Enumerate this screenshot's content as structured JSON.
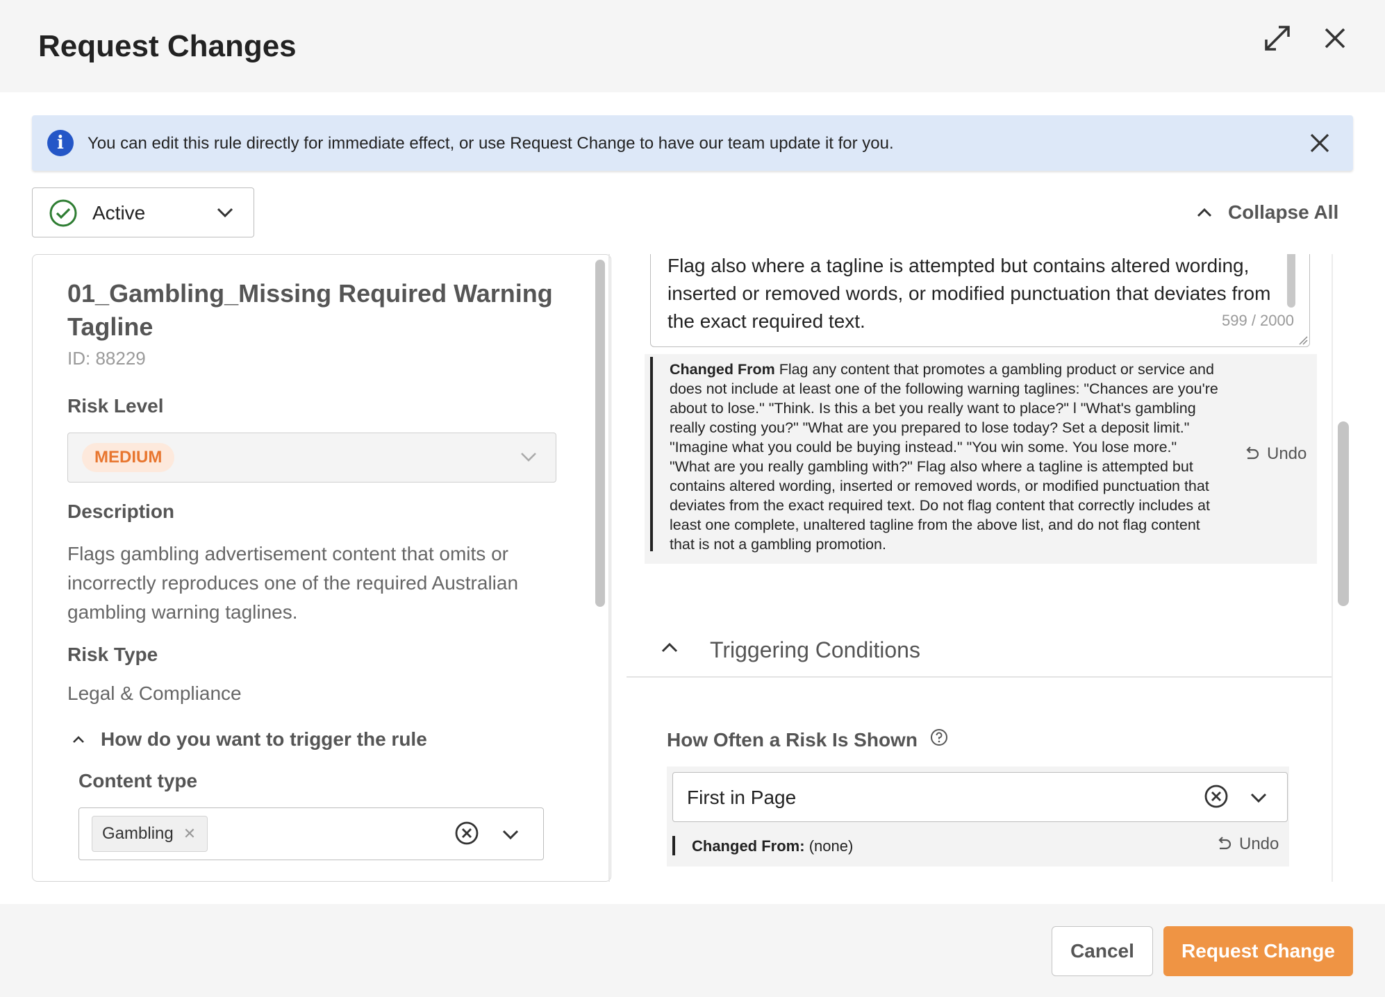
{
  "modal": {
    "title": "Request Changes",
    "expand_icon": "expand-arrows-icon",
    "close_icon": "close-icon"
  },
  "banner": {
    "icon": "info-icon",
    "icon_glyph": "i",
    "text": "You can edit this rule directly for immediate effect, or use Request Change to have our team update it for you.",
    "close_icon": "close-icon"
  },
  "status": {
    "value": "Active",
    "icon": "check-circle-icon",
    "color": "#2e7d32"
  },
  "collapse_all": {
    "label": "Collapse All"
  },
  "rule": {
    "name": "01_Gambling_Missing Required Warning Tagline",
    "id_text": "ID: 88229",
    "risk_level_label": "Risk Level",
    "risk_level_value": "MEDIUM",
    "risk_level_color": "#e8762f",
    "description_label": "Description",
    "description": "Flags gambling advertisement content that omits or incorrectly reproduces one of the required Australian gambling warning taglines.",
    "risk_type_label": "Risk Type",
    "risk_type_value": "Legal & Compliance",
    "trigger_section_label": "How do you want to trigger the rule",
    "content_type_label": "Content type",
    "content_type_tags": [
      "Gambling"
    ]
  },
  "prompt": {
    "text": "Flag also where a tagline is attempted but contains altered wording, inserted or removed words, or modified punctuation that deviates from the exact required text.",
    "char_count": "599 / 2000",
    "changed_from_label": "Changed From",
    "changed_from_text": "Flag any content that promotes a gambling product or service and does not include at least one of the following warning taglines: \"Chances are you're about to lose.\" \"Think. Is this a bet you really want to place?\" l \"What's gambling really costing you?\" \"What are you prepared to lose today? Set a deposit limit.\" \"Imagine what you could be buying instead.\" \"You win some. You lose more.\" \"What are you really gambling with?\" Flag also where a tagline is attempted but contains altered wording, inserted or removed words, or modified punctuation that deviates from the exact required text. Do not flag content that correctly includes at least one complete, unaltered tagline from the above list, and do not flag content that is not a gambling promotion.",
    "undo_label": "Undo"
  },
  "triggering": {
    "title": "Triggering Conditions",
    "frequency_label": "How Often a Risk Is Shown",
    "frequency_value": "First in Page",
    "changed_from_label": "Changed From:",
    "changed_from_value": "(none)",
    "undo_label": "Undo"
  },
  "footer": {
    "cancel_label": "Cancel",
    "submit_label": "Request Change",
    "submit_color": "#ef9444"
  }
}
